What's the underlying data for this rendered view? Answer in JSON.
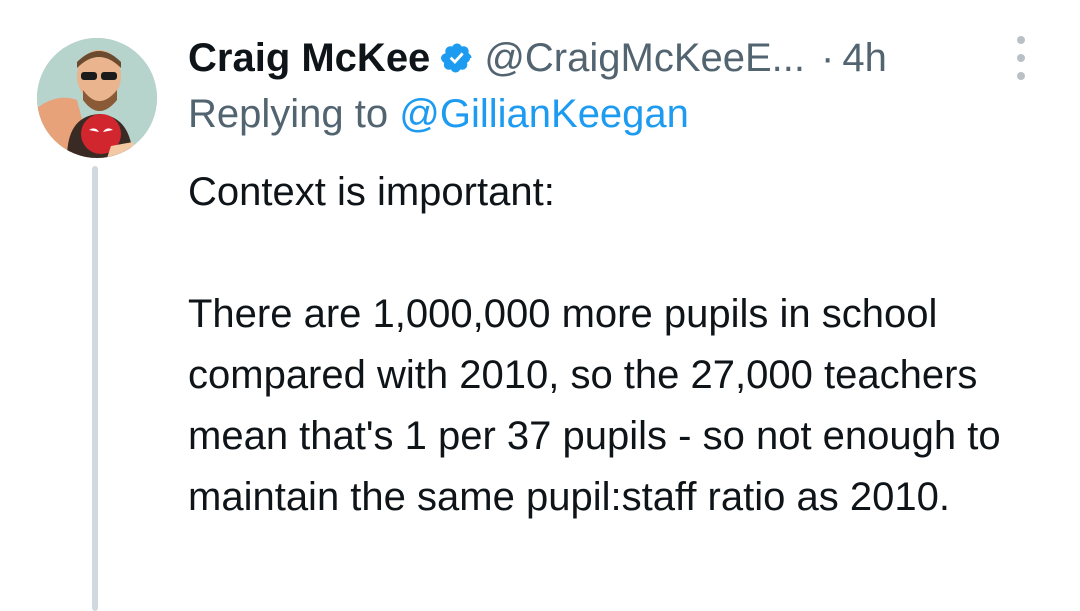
{
  "author": {
    "display_name": "Craig McKee",
    "handle": "@CraigMcKeeE...",
    "dot": "·",
    "time": "4h",
    "verified_icon": "verified-badge-icon",
    "avatar_icon": "avatar"
  },
  "reply": {
    "prefix": "Replying to",
    "target": "@GillianKeegan"
  },
  "tweet": {
    "line1": "Context is important:",
    "line2": "There are 1,000,000 more pupils in school compared with 2010, so the 27,000 teachers mean that's 1 per 37 pupils - so not enough to maintain the same pupil:staff ratio as 2010."
  },
  "colors": {
    "text": "#0f1419",
    "secondary": "#536471",
    "link": "#1d9bf0",
    "thread_line": "#cfd9de"
  }
}
